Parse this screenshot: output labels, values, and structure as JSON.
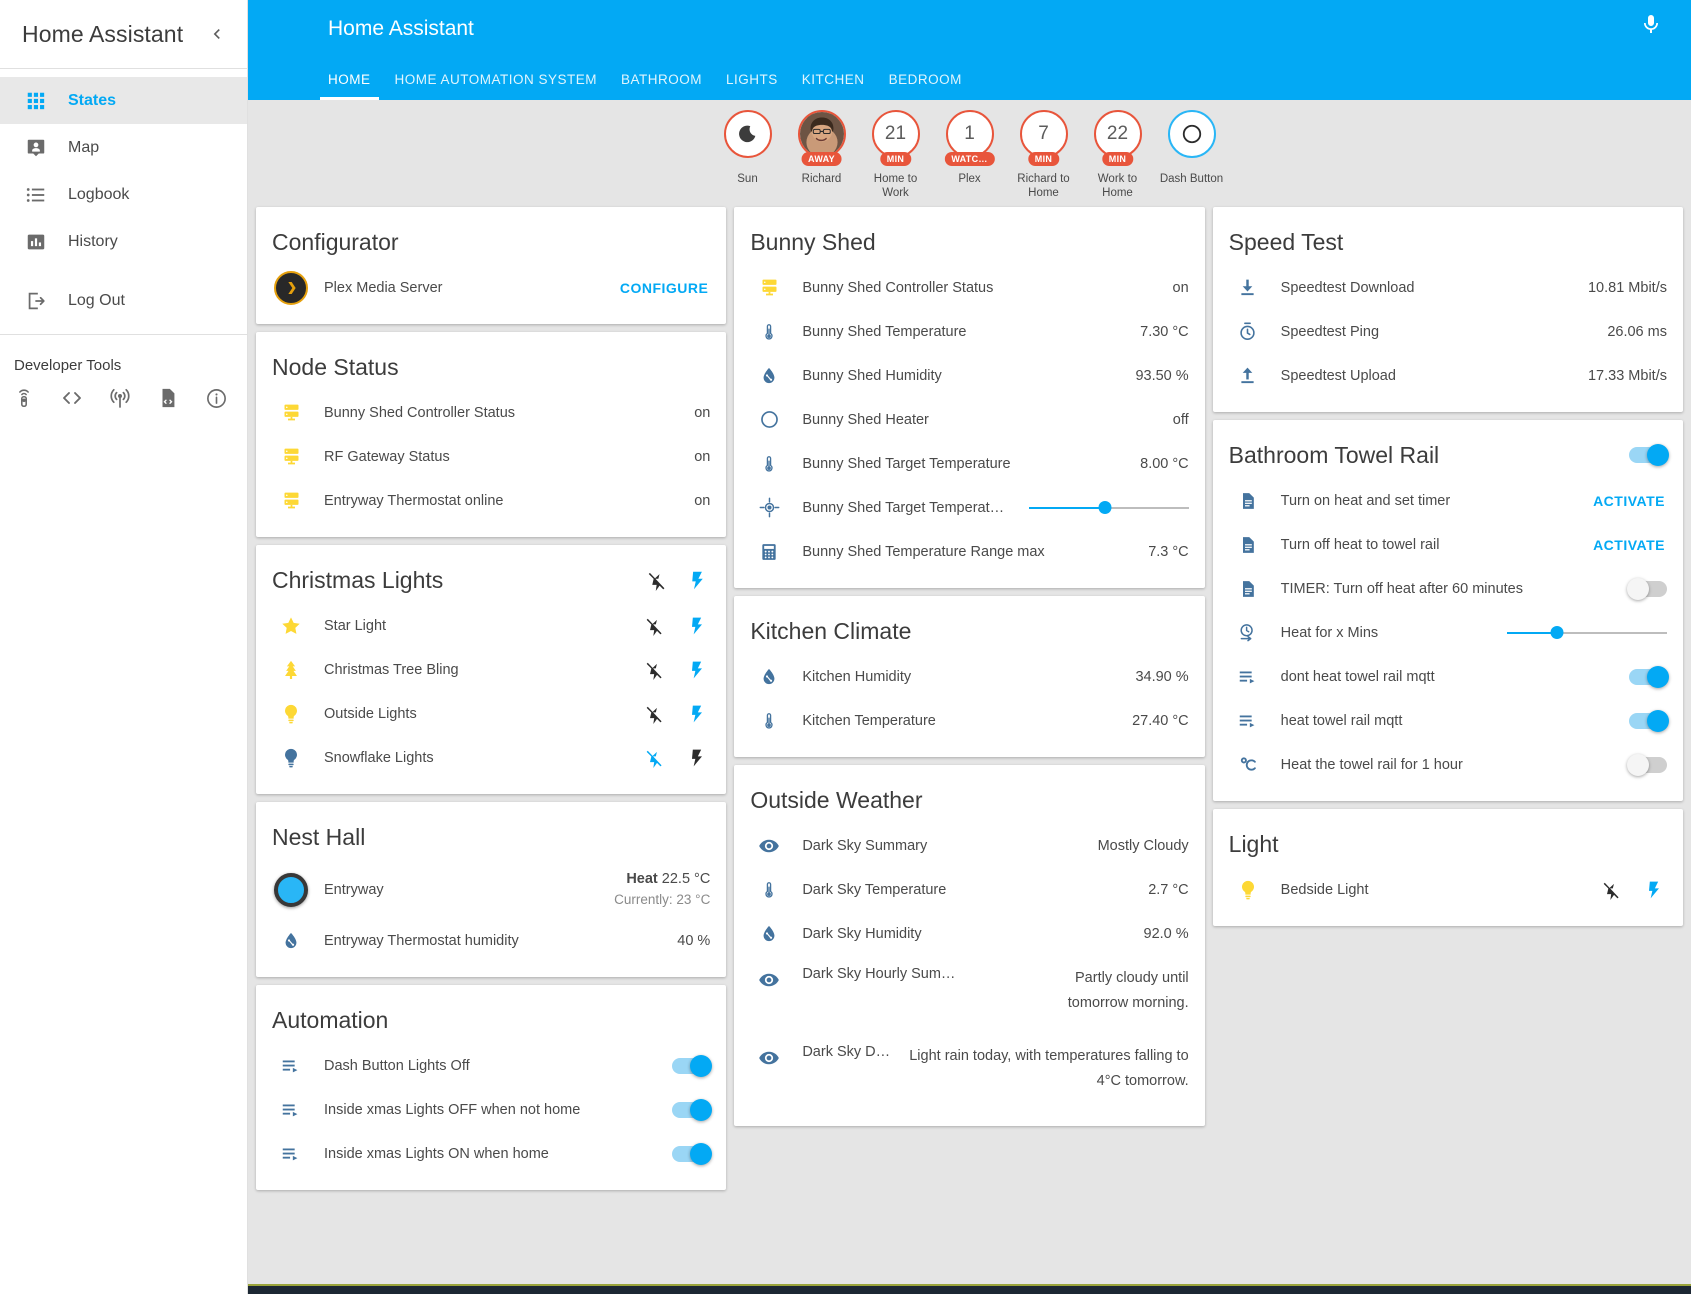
{
  "sidebar": {
    "title": "Home Assistant",
    "collapse_icon": "chevron-left-icon",
    "items": [
      {
        "label": "States",
        "icon": "grid-icon",
        "active": true
      },
      {
        "label": "Map",
        "icon": "account-badge-icon",
        "active": false
      },
      {
        "label": "Logbook",
        "icon": "list-icon",
        "active": false
      },
      {
        "label": "History",
        "icon": "chart-bar-icon",
        "active": false
      },
      {
        "label": "Log Out",
        "icon": "logout-icon",
        "active": false
      }
    ],
    "developer_tools_label": "Developer Tools",
    "developer_icons": [
      "remote-icon",
      "code-tags-icon",
      "broadcast-icon",
      "file-code-icon",
      "information-icon"
    ]
  },
  "toolbar": {
    "title": "Home Assistant",
    "mic_icon": "microphone-icon",
    "tabs": [
      {
        "label": "HOME",
        "active": true
      },
      {
        "label": "HOME AUTOMATION SYSTEM",
        "active": false
      },
      {
        "label": "BATHROOM",
        "active": false
      },
      {
        "label": "LIGHTS",
        "active": false
      },
      {
        "label": "KITCHEN",
        "active": false
      },
      {
        "label": "BEDROOM",
        "active": false
      }
    ]
  },
  "badges": [
    {
      "name": "Sun",
      "glyph": "☾",
      "pill": "",
      "kind": "moon",
      "ring": "orange"
    },
    {
      "name": "Richard",
      "glyph": "",
      "pill": "AWAY",
      "kind": "avatar",
      "ring": "orange"
    },
    {
      "name": "Home to Work",
      "glyph": "21",
      "pill": "MIN",
      "kind": "number",
      "ring": "orange"
    },
    {
      "name": "Plex",
      "glyph": "1",
      "pill": "WATC…",
      "kind": "number",
      "ring": "orange"
    },
    {
      "name": "Richard to Home",
      "glyph": "7",
      "pill": "MIN",
      "kind": "number",
      "ring": "orange"
    },
    {
      "name": "Work to Home",
      "glyph": "22",
      "pill": "MIN",
      "kind": "number",
      "ring": "orange"
    },
    {
      "name": "Dash Button",
      "glyph": "◯",
      "pill": "",
      "kind": "circle",
      "ring": "blue"
    }
  ],
  "cards": {
    "configurator": {
      "title": "Configurator",
      "rows": [
        {
          "name": "Plex Media Server",
          "icon": "plex-icon",
          "action_label": "CONFIGURE"
        }
      ]
    },
    "node_status": {
      "title": "Node Status",
      "rows": [
        {
          "name": "Bunny Shed Controller Status",
          "icon": "server-icon",
          "value": "on"
        },
        {
          "name": "RF Gateway Status",
          "icon": "server-icon",
          "value": "on"
        },
        {
          "name": "Entryway Thermostat online",
          "icon": "server-icon",
          "value": "on"
        }
      ]
    },
    "christmas_lights": {
      "title": "Christmas Lights",
      "header_icons": [
        "flash-off-icon",
        "flash-icon"
      ],
      "rows": [
        {
          "name": "Star Light",
          "icon": "star-icon",
          "icon_color": "#fdd835",
          "off_icon": "flash-off-icon",
          "on_icon": "flash-icon",
          "state": "off"
        },
        {
          "name": "Christmas Tree Bling",
          "icon": "tree-icon",
          "icon_color": "#fdd835",
          "off_icon": "flash-off-icon",
          "on_icon": "flash-icon",
          "state": "off"
        },
        {
          "name": "Outside Lights",
          "icon": "lightbulb-icon",
          "icon_color": "#fdd835",
          "off_icon": "flash-off-icon",
          "on_icon": "flash-icon",
          "state": "off"
        },
        {
          "name": "Snowflake Lights",
          "icon": "lightbulb-icon",
          "icon_color": "#44739e",
          "off_icon": "flash-off-icon",
          "on_icon": "flash-icon",
          "state": "on"
        }
      ]
    },
    "nest_hall": {
      "title": "Nest Hall",
      "rows": [
        {
          "name": "Entryway",
          "icon": "thermostat-dial-icon",
          "mode": "Heat",
          "target": "22.5 °C",
          "current": "Currently: 23 °C"
        },
        {
          "name": "Entryway Thermostat humidity",
          "icon": "water-percent-icon",
          "value": "40 %"
        }
      ]
    },
    "automation": {
      "title": "Automation",
      "rows": [
        {
          "name": "Dash Button Lights Off",
          "icon": "playlist-play-icon",
          "state": "on"
        },
        {
          "name": "Inside xmas Lights OFF when not home",
          "icon": "playlist-play-icon",
          "state": "on"
        },
        {
          "name": "Inside xmas Lights ON when home",
          "icon": "playlist-play-icon",
          "state": "on"
        }
      ]
    },
    "bunny_shed": {
      "title": "Bunny Shed",
      "rows": [
        {
          "name": "Bunny Shed Controller Status",
          "icon": "server-icon",
          "value": "on"
        },
        {
          "name": "Bunny Shed Temperature",
          "icon": "thermometer-icon",
          "value": "7.30 °C"
        },
        {
          "name": "Bunny Shed Humidity",
          "icon": "water-percent-icon",
          "value": "93.50 %"
        },
        {
          "name": "Bunny Shed Heater",
          "icon": "circle-outline-icon",
          "value": "off"
        },
        {
          "name": "Bunny Shed Target Temperature",
          "icon": "thermometer-icon",
          "value": "8.00 °C"
        },
        {
          "name": "Bunny Shed Target Temperat…",
          "icon": "crosshairs-gps-icon",
          "slider": 48
        },
        {
          "name": "Bunny Shed Temperature Range max",
          "icon": "calculator-icon",
          "value": "7.3 °C"
        }
      ]
    },
    "kitchen_climate": {
      "title": "Kitchen Climate",
      "rows": [
        {
          "name": "Kitchen Humidity",
          "icon": "water-percent-icon",
          "value": "34.90 %"
        },
        {
          "name": "Kitchen Temperature",
          "icon": "thermometer-icon",
          "value": "27.40 °C"
        }
      ]
    },
    "outside_weather": {
      "title": "Outside Weather",
      "rows": [
        {
          "name": "Dark Sky Summary",
          "icon": "eye-icon",
          "value": "Mostly Cloudy"
        },
        {
          "name": "Dark Sky Temperature",
          "icon": "thermometer-icon",
          "value": "2.7 °C"
        },
        {
          "name": "Dark Sky Humidity",
          "icon": "water-percent-icon",
          "value": "92.0 %"
        },
        {
          "name": "Dark Sky Hourly Sum…",
          "icon": "eye-icon",
          "value": "Partly cloudy until tomorrow morning.",
          "multiline": true
        },
        {
          "name": "Dark Sky Dail…",
          "icon": "eye-icon",
          "value": "Light rain today, with temperatures falling to 4°C tomorrow.",
          "multiline": true
        }
      ]
    },
    "speed_test": {
      "title": "Speed Test",
      "rows": [
        {
          "name": "Speedtest Download",
          "icon": "download-icon",
          "value": "10.81 Mbit/s"
        },
        {
          "name": "Speedtest Ping",
          "icon": "timer-icon",
          "value": "26.06 ms"
        },
        {
          "name": "Speedtest Upload",
          "icon": "upload-icon",
          "value": "17.33 Mbit/s"
        }
      ]
    },
    "bathroom_towel_rail": {
      "title": "Bathroom Towel Rail",
      "header_toggle": "on",
      "rows": [
        {
          "name": "Turn on heat and set timer",
          "icon": "script-icon",
          "action_label": "ACTIVATE"
        },
        {
          "name": "Turn off heat to towel rail",
          "icon": "script-icon",
          "action_label": "ACTIVATE"
        },
        {
          "name": "TIMER: Turn off heat after 60 minutes",
          "icon": "script-icon",
          "state": "off"
        },
        {
          "name": "Heat for x Mins",
          "icon": "timer-sand-icon",
          "slider": 31
        },
        {
          "name": "dont heat towel rail mqtt",
          "icon": "playlist-play-icon",
          "state": "on"
        },
        {
          "name": "heat towel rail mqtt",
          "icon": "playlist-play-icon",
          "state": "on"
        },
        {
          "name": "Heat the towel rail for 1 hour",
          "icon": "celsius-icon",
          "state": "off"
        }
      ]
    },
    "light": {
      "title": "Light",
      "rows": [
        {
          "name": "Bedside Light",
          "icon": "lightbulb-icon",
          "icon_color": "#fdd835",
          "off_icon": "flash-off-icon",
          "on_icon": "flash-icon",
          "state": "off"
        }
      ]
    }
  }
}
